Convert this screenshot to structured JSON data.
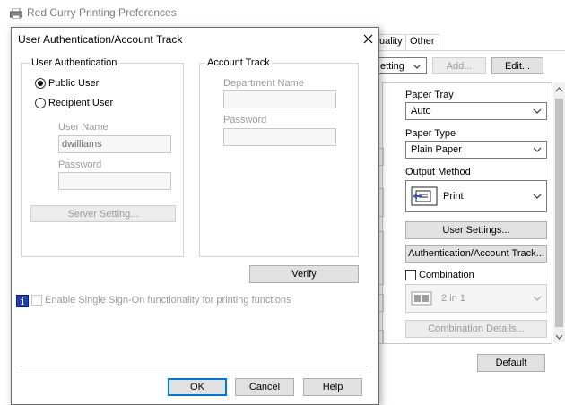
{
  "background_window": {
    "title": "Red Curry Printing Preferences",
    "tabs": [
      "uality",
      "Other"
    ],
    "setting_combo": "etting",
    "add_label": "Add...",
    "edit_label": "Edit...",
    "paper_tray_label": "Paper Tray",
    "paper_tray_value": "Auto",
    "paper_type_label": "Paper Type",
    "paper_type_value": "Plain Paper",
    "output_method_label": "Output Method",
    "output_method_value": "Print",
    "user_settings_label": "User Settings...",
    "auth_account_label": "Authentication/Account Track...",
    "combination_label": "Combination",
    "combination_value": "2 in 1",
    "combination_details_label": "Combination Details...",
    "default_label": "Default"
  },
  "dialog": {
    "title": "User Authentication/Account Track",
    "user_auth": {
      "legend": "User Authentication",
      "public_user": "Public User",
      "recipient_user": "Recipient User",
      "selected": "public",
      "user_name_label": "User Name",
      "user_name_value": "dwilliams",
      "password_label": "Password",
      "password_value": "",
      "server_setting": "Server Setting..."
    },
    "account_track": {
      "legend": "Account Track",
      "department_label": "Department Name",
      "department_value": "",
      "password_label": "Password",
      "password_value": ""
    },
    "verify_label": "Verify",
    "sso_label": "Enable Single Sign-On functionality for printing functions",
    "ok_label": "OK",
    "cancel_label": "Cancel",
    "help_label": "Help"
  },
  "icons": {
    "info": "i"
  },
  "colors": {
    "accent": "#0078d7",
    "info_icon": "#1f3fb5"
  }
}
